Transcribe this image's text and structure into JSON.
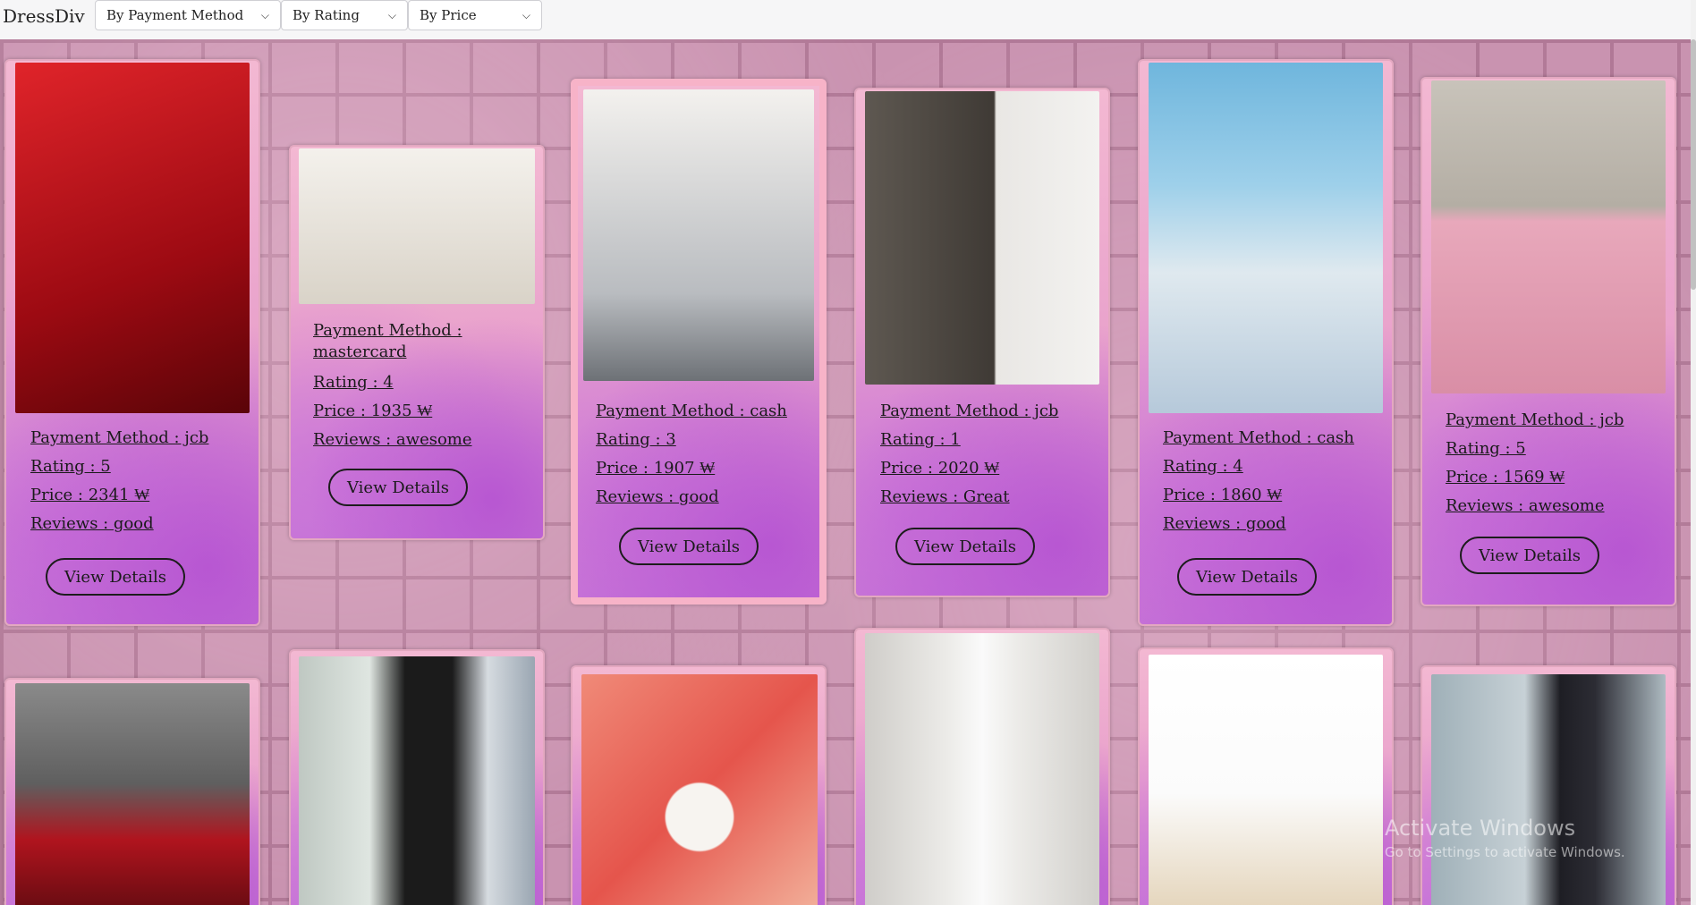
{
  "app": {
    "brand": "DressDiv"
  },
  "filters": [
    {
      "label": "By Payment Method"
    },
    {
      "label": "By Rating"
    },
    {
      "label": "By Price"
    }
  ],
  "cards": [
    {
      "payment": "Payment Method : jcb",
      "rating": "Rating : 5",
      "price": "Price : 2341 ₩",
      "reviews": "Reviews : good",
      "button": "View Details",
      "photo_colors": [
        "#c2141a",
        "#7a0a10"
      ]
    },
    {
      "payment": "Payment Method : mastercard",
      "rating": "Rating : 4",
      "price": "Price : 1935 ₩",
      "reviews": "Reviews : awesome",
      "button": "View Details",
      "photo_colors": [
        "#f1eee8",
        "#c9c2b4"
      ]
    },
    {
      "payment": "Payment Method : cash",
      "rating": "Rating : 3",
      "price": "Price : 1907 ₩",
      "reviews": "Reviews : good",
      "button": "View Details",
      "photo_colors": [
        "#e6e4e0",
        "#8d8f93"
      ]
    },
    {
      "payment": "Payment Method : jcb",
      "rating": "Rating : 1",
      "price": "Price : 2020 ₩",
      "reviews": "Reviews : Great",
      "button": "View Details",
      "photo_colors": [
        "#56504a",
        "#1c2233"
      ]
    },
    {
      "payment": "Payment Method : cash",
      "rating": "Rating : 4",
      "price": "Price : 1860 ₩",
      "reviews": "Reviews : good",
      "button": "View Details",
      "photo_colors": [
        "#8fc3e0",
        "#dfe8ef"
      ]
    },
    {
      "payment": "Payment Method : jcb",
      "rating": "Rating : 5",
      "price": "Price : 1569 ₩",
      "reviews": "Reviews : awesome",
      "button": "View Details",
      "photo_colors": [
        "#bcb7ad",
        "#e6a6b8"
      ]
    }
  ],
  "row2_photos": [
    {
      "colors": [
        "#6e6e6e",
        "#a3121c"
      ]
    },
    {
      "colors": [
        "#cfd6d0",
        "#1a1a1a"
      ]
    },
    {
      "colors": [
        "#e8776a",
        "#f3efe9"
      ]
    },
    {
      "colors": [
        "#d8d6d2",
        "#f5f5f5"
      ]
    },
    {
      "colors": [
        "#ffffff",
        "#e8dac4"
      ]
    },
    {
      "colors": [
        "#9fb0b8",
        "#1e1e24"
      ]
    }
  ],
  "watermark": {
    "line1": "Activate Windows",
    "line2": "Go to Settings to activate Windows."
  }
}
